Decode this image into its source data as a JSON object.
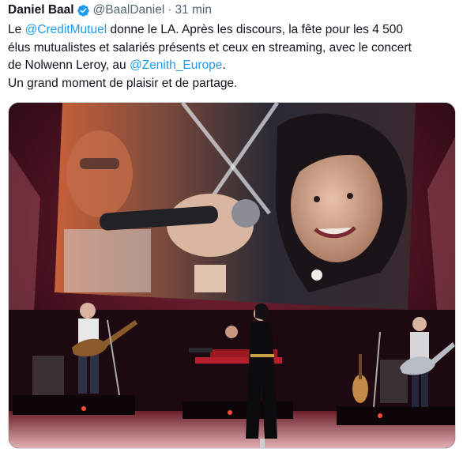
{
  "author": {
    "display_name": "Daniel Baal",
    "verified_icon": "verified-badge-icon",
    "handle": "@BaalDaniel",
    "separator": "·",
    "timestamp": "31 min"
  },
  "tweet": {
    "line1": {
      "t1": "Le ",
      "m1": "@CreditMutuel",
      "t2": " donne le LA. Après les discours, la fête pour les 4 500"
    },
    "line2": "élus mutualistes et salariés présents et ceux en streaming, avec le concert",
    "line3": {
      "t1": "de Nolwenn Leroy, au ",
      "m1": "@Zenith_Europe",
      "t2": "."
    },
    "line4": "Un grand moment de plaisir et de partage."
  },
  "media": {
    "type": "photo",
    "subject": "concert-stage-photo"
  },
  "colors": {
    "link": "#1d9bf0",
    "secondary_text": "#536471",
    "verified": "#1d9bf0"
  }
}
